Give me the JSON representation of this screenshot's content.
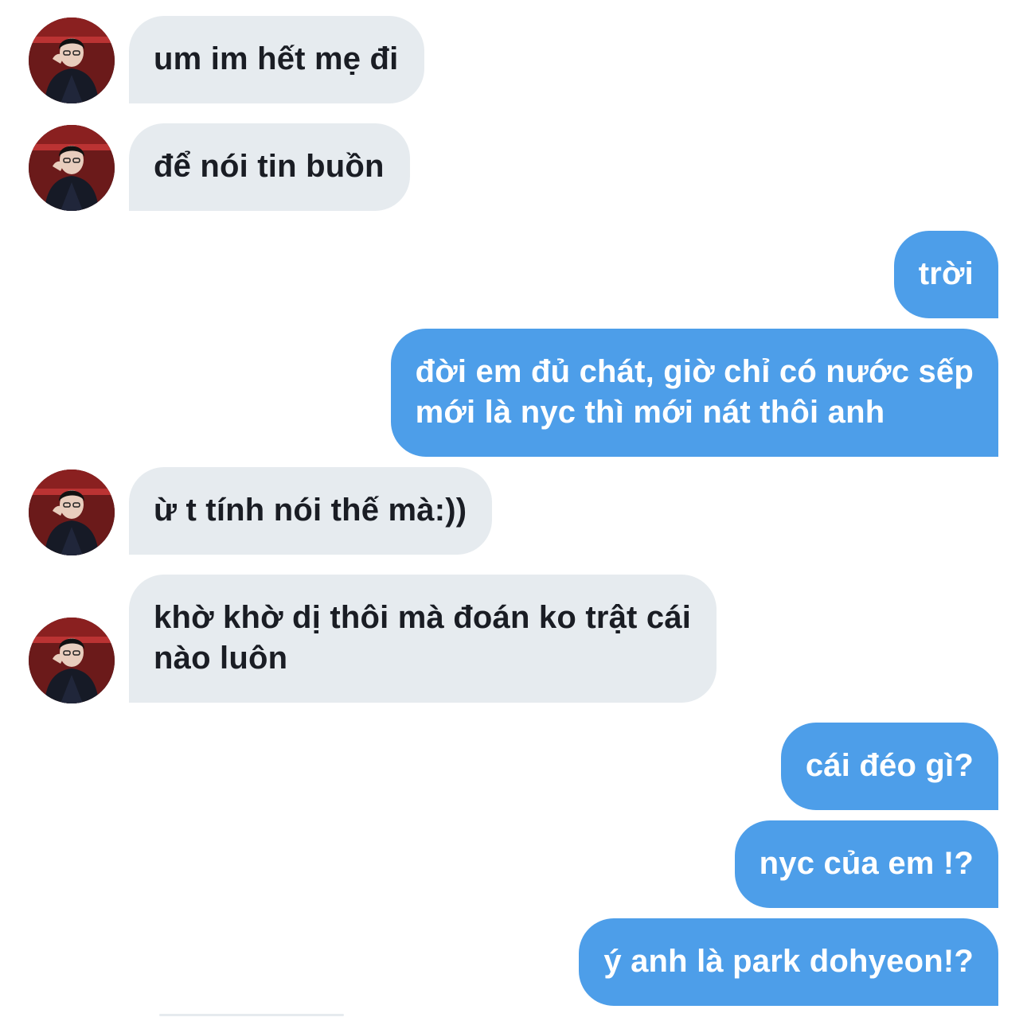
{
  "colors": {
    "incoming_bubble": "#e6ebef",
    "outgoing_bubble": "#4d9ee9",
    "incoming_text": "#1a1d24",
    "outgoing_text": "#ffffff",
    "background": "#ffffff"
  },
  "messages": [
    {
      "sender": "them",
      "text": "um im hết mẹ đi"
    },
    {
      "sender": "them",
      "text": "để nói tin buồn"
    },
    {
      "sender": "me",
      "text": "trời"
    },
    {
      "sender": "me",
      "text": "đời em đủ chát, giờ chỉ có nước sếp\nmới là nyc thì mới nát thôi anh"
    },
    {
      "sender": "them",
      "text": "ừ t tính nói thế mà:))"
    },
    {
      "sender": "them",
      "text": "khờ khờ dị thôi mà đoán ko trật cái\nnào luôn"
    },
    {
      "sender": "me",
      "text": "cái đéo gì?"
    },
    {
      "sender": "me",
      "text": "nyc của em !?"
    },
    {
      "sender": "me",
      "text": "ý anh là park dohyeon!?"
    }
  ]
}
